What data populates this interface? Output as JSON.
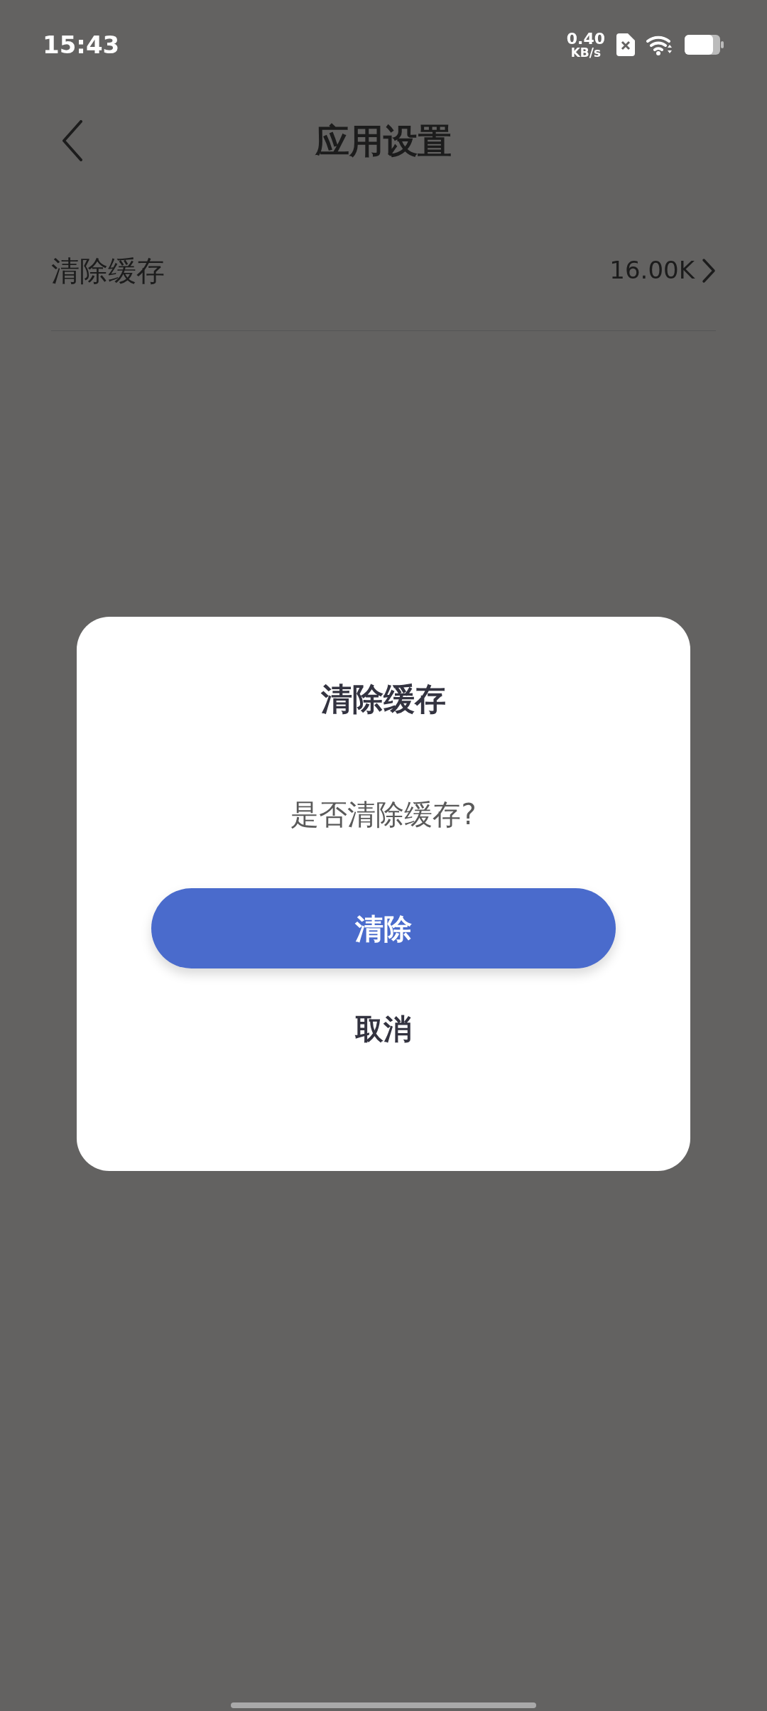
{
  "status_bar": {
    "time": "15:43",
    "net_speed": "0.40",
    "net_unit": "KB/s"
  },
  "header": {
    "title": "应用设置"
  },
  "settings": [
    {
      "label": "清除缓存",
      "value": "16.00K"
    }
  ],
  "dialog": {
    "title": "清除缓存",
    "message": "是否清除缓存?",
    "confirm": "清除",
    "cancel": "取消"
  }
}
